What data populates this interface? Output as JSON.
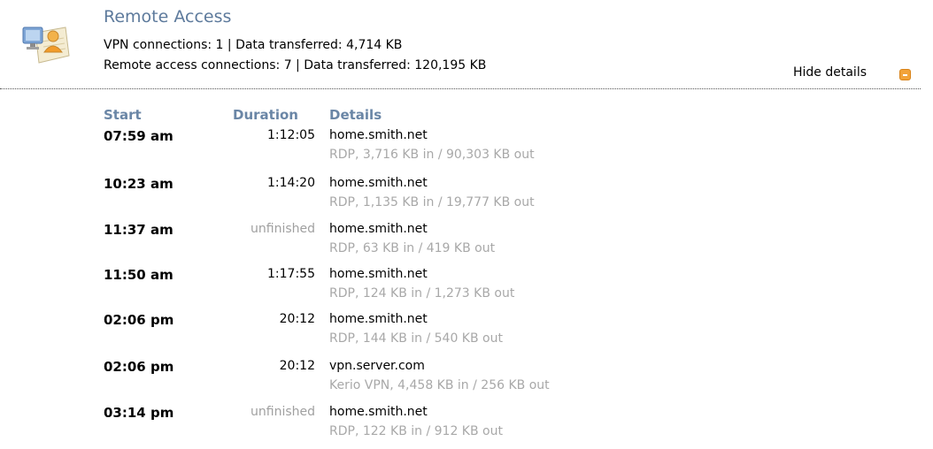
{
  "header": {
    "icon": "remote-access-icon",
    "title": "Remote Access",
    "vpn_line": "VPN connections: 1 | Data transferred: 4,714 KB",
    "remote_line": "Remote access connections: 7 | Data transferred: 120,195 KB",
    "hide_details": "Hide details",
    "collapse_icon": "collapse-icon",
    "accent_color": "#5d7a9c"
  },
  "table": {
    "columns": [
      "Start",
      "Duration",
      "Details"
    ],
    "rows": [
      {
        "start": "07:59 am",
        "duration": "1:12:05",
        "host": "home.smith.net",
        "info": "RDP, 3,716 KB in / 90,303 KB out"
      },
      {
        "start": "10:23 am",
        "duration": "1:14:20",
        "host": "home.smith.net",
        "info": "RDP, 1,135 KB in / 19,777 KB out"
      },
      {
        "start": "11:37 am",
        "duration": "unfinished",
        "host": "home.smith.net",
        "info": "RDP, 63 KB in / 419 KB out"
      },
      {
        "start": "11:50 am",
        "duration": "1:17:55",
        "host": "home.smith.net",
        "info": "RDP, 124 KB in / 1,273 KB out"
      },
      {
        "start": "02:06 pm",
        "duration": "20:12",
        "host": "home.smith.net",
        "info": "RDP, 144 KB in / 540 KB out"
      },
      {
        "start": "02:06 pm",
        "duration": "20:12",
        "host": "vpn.server.com",
        "info": "Kerio VPN, 4,458 KB in / 256 KB out"
      },
      {
        "start": "03:14 pm",
        "duration": "unfinished",
        "host": "home.smith.net",
        "info": "RDP, 122 KB in / 912 KB out"
      }
    ]
  }
}
